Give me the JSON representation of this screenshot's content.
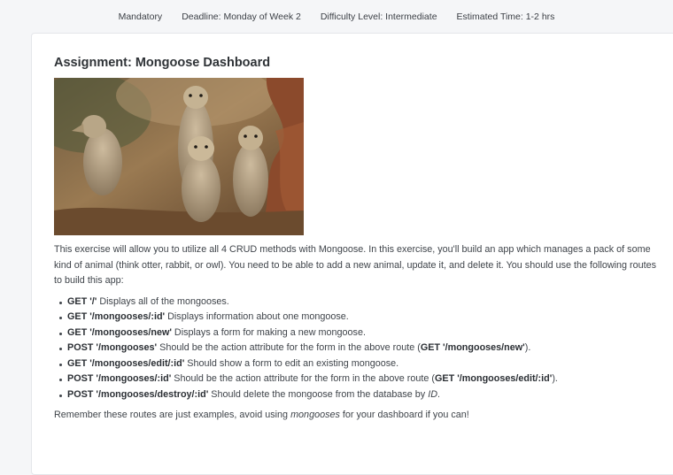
{
  "header": {
    "mandatory": "Mandatory",
    "deadline": "Deadline: Monday of Week 2",
    "difficulty": "Difficulty Level: Intermediate",
    "estimated_time": "Estimated Time: 1-2 hrs"
  },
  "assignment": {
    "title": "Assignment: Mongoose Dashboard",
    "image_desc": "mongoose-photo",
    "intro": "This exercise will allow you to utilize all 4 CRUD methods with Mongoose. In this exercise, you'll build an app which manages a pack of some kind of animal (think otter, rabbit, or owl). You need to be able to add a new animal, update it, and delete it. You should use the following routes to build this app:",
    "routes": [
      {
        "route": "GET '/'",
        "desc": " Displays all of the mongooses."
      },
      {
        "route": "GET '/mongooses/:id'",
        "desc": " Displays information about one mongoose."
      },
      {
        "route": "GET '/mongooses/new'",
        "desc": " Displays a form for making a new mongoose."
      },
      {
        "route": "POST '/mongooses'",
        "desc": " Should be the action attribute for the form in the above route (",
        "ref": "GET '/mongooses/new'",
        "tail": ")."
      },
      {
        "route": "GET '/mongooses/edit/:id'",
        "desc": " Should show a form to edit an existing mongoose."
      },
      {
        "route": "POST '/mongooses/:id'",
        "desc": " Should be the action attribute for the form in the above route (",
        "ref": "GET '/mongooses/edit/:id'",
        "tail": ")."
      },
      {
        "route": "POST '/mongooses/destroy/:id'",
        "desc": " Should delete the mongoose from the database by ",
        "ref_italic": "ID",
        "tail": "."
      }
    ],
    "footer_pre": "Remember these routes are just examples, avoid using ",
    "footer_italic": "mongooses",
    "footer_post": " for your dashboard if you can!"
  }
}
